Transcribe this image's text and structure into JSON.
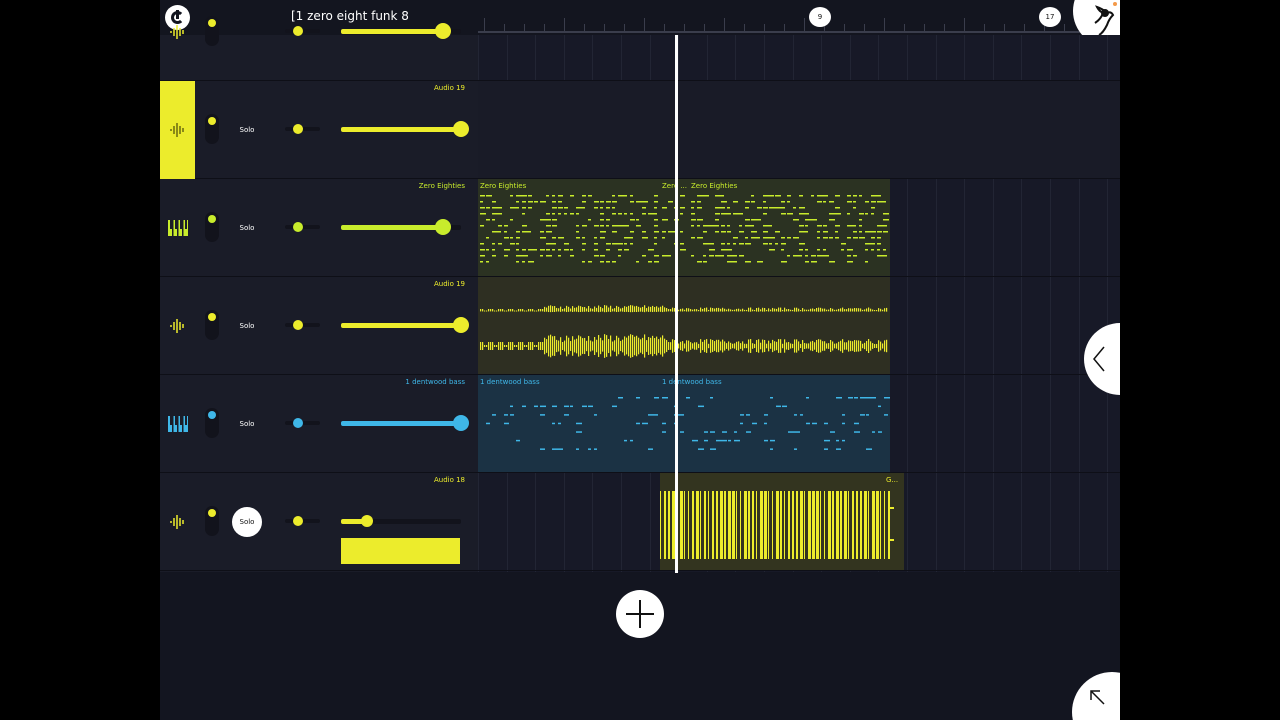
{
  "project": {
    "title": "[1 zero eight funk 8"
  },
  "ruler": {
    "markers": [
      "9",
      "17"
    ]
  },
  "colors": {
    "yellow": "#ecec2c",
    "green_yellow": "#c8ec2c",
    "blue": "#3fb7e8",
    "background": "#131520",
    "panel": "#1a1c28"
  },
  "tracks": [
    {
      "name": "",
      "icon": "waveform-icon",
      "color": "#ecec2c",
      "volume": 0.85
    },
    {
      "name": "Audio 19",
      "icon": "waveform-icon",
      "color": "#ecec2c",
      "selected": true,
      "solo_label": "Solo",
      "volume": 1.0
    },
    {
      "name": "Zero Eighties",
      "icon": "piano-icon",
      "color": "#c8ec2c",
      "solo_label": "Solo",
      "volume": 0.85
    },
    {
      "name": "Audio 19",
      "icon": "waveform-icon",
      "color": "#ecec2c",
      "solo_label": "Solo",
      "volume": 1.0
    },
    {
      "name": "1 dentwood bass",
      "icon": "piano-icon",
      "color": "#3fb7e8",
      "solo_label": "Solo",
      "volume": 1.0
    },
    {
      "name": "Audio 18",
      "icon": "waveform-icon",
      "color": "#ecec2c",
      "solo_label": "Solo",
      "solo_on": true,
      "volume": 0.22
    }
  ],
  "clips": {
    "zero_eighties_1": "Zero Eighties",
    "zero_eighties_2": "Zero ...",
    "zero_eighties_3": "Zero Eighties",
    "dentwood_1": "1 dentwood bass",
    "dentwood_2": "1 dentwood bass",
    "audio18": "G..."
  }
}
